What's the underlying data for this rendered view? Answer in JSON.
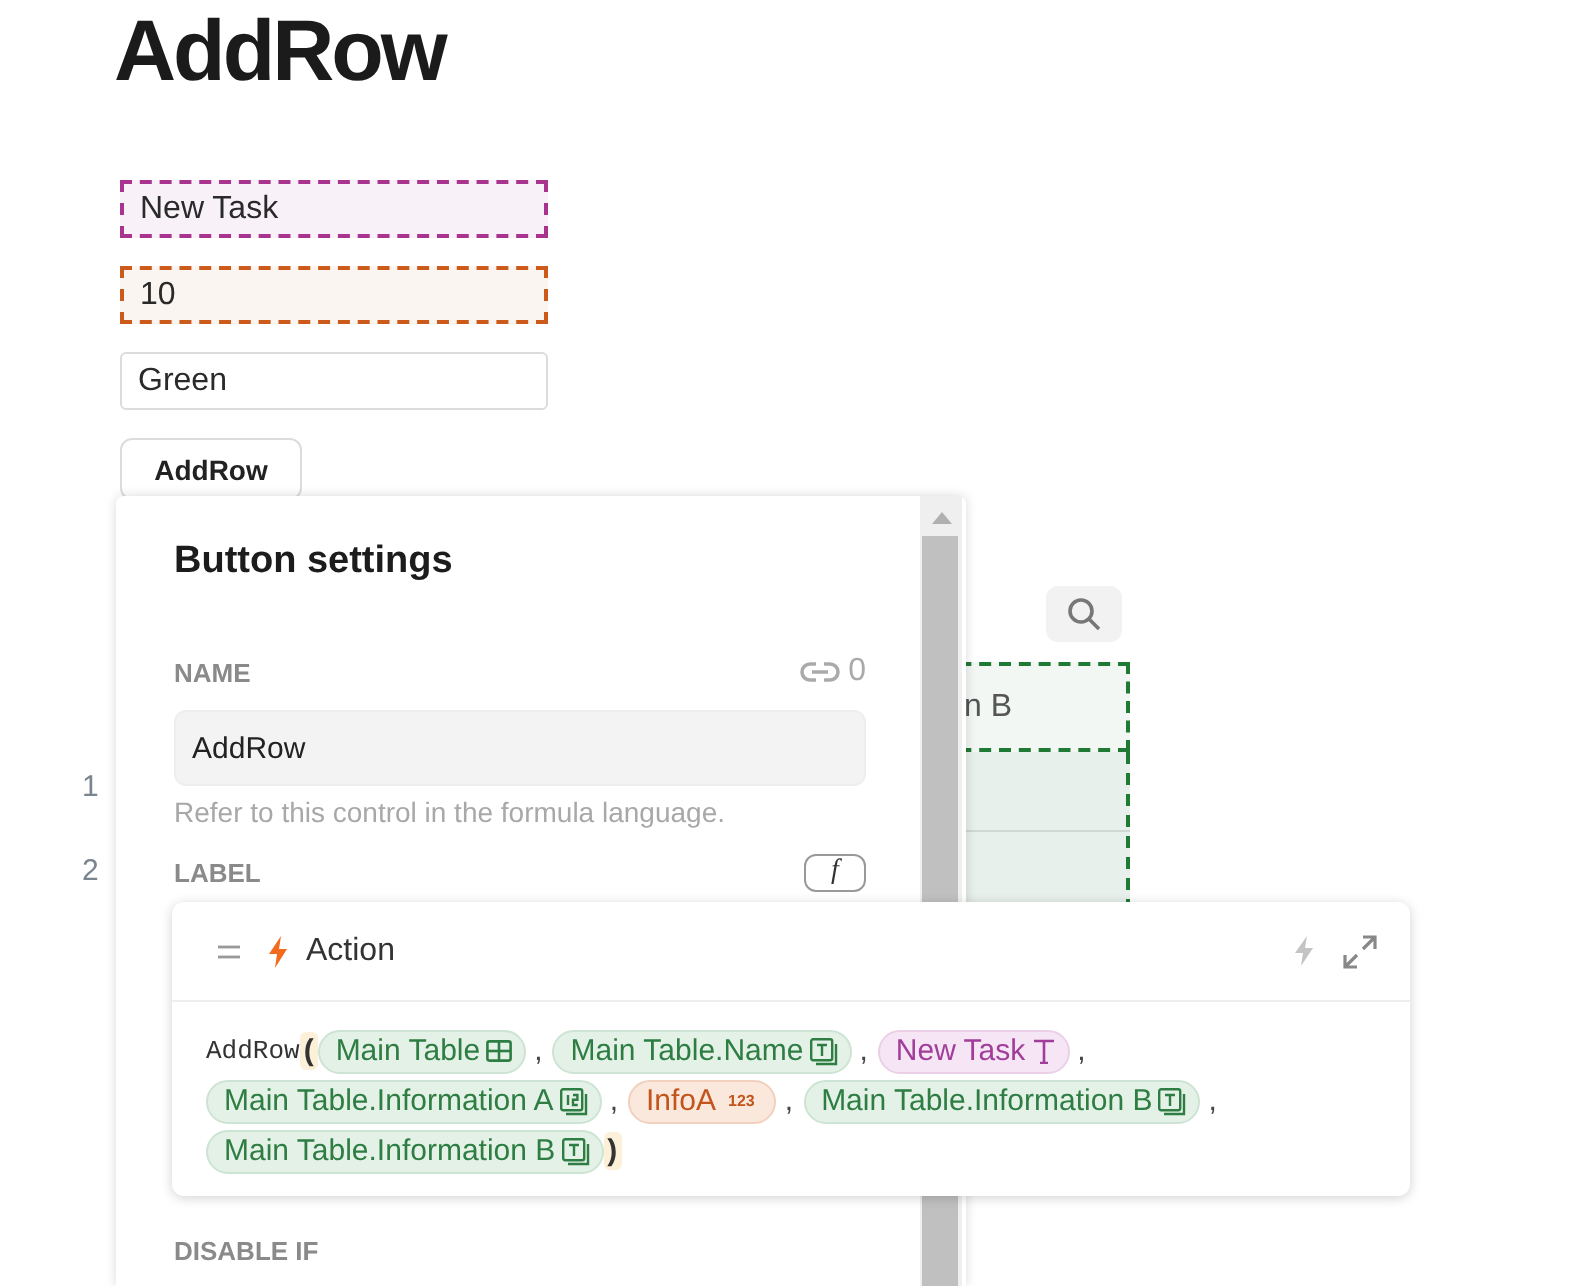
{
  "page": {
    "title": "AddRow"
  },
  "inputs": [
    {
      "kind": "text",
      "value": "New Task"
    },
    {
      "kind": "number",
      "value": "10"
    },
    {
      "kind": "plain",
      "value": "Green"
    }
  ],
  "button": {
    "label": "AddRow"
  },
  "canvas": {
    "table_header": "n B",
    "row_numbers": [
      "1",
      "2"
    ]
  },
  "settings_panel": {
    "title": "Button settings",
    "name": {
      "label": "NAME",
      "references": "0",
      "value": "AddRow",
      "hint": "Refer to this control in the formula language."
    },
    "label_field": {
      "label": "LABEL",
      "formula_button": "f"
    },
    "disable_if": {
      "label": "DISABLE IF"
    }
  },
  "formula_popup": {
    "title": "Action",
    "lines": [
      [
        {
          "kind": "function",
          "text": "AddRow"
        },
        {
          "kind": "paren",
          "text": "("
        },
        {
          "kind": "table",
          "text": "Main Table"
        },
        {
          "kind": "comma",
          "text": ","
        },
        {
          "kind": "column",
          "text": "Main Table.Name"
        },
        {
          "kind": "comma",
          "text": ","
        },
        {
          "kind": "text",
          "text": "New Task"
        },
        {
          "kind": "comma",
          "text": ","
        }
      ],
      [
        {
          "kind": "number-column",
          "text": "Main Table.Information A"
        },
        {
          "kind": "comma",
          "text": ","
        },
        {
          "kind": "number",
          "text": "InfoA",
          "badge": "123"
        },
        {
          "kind": "comma",
          "text": ","
        },
        {
          "kind": "column",
          "text": "Main Table.Information B"
        },
        {
          "kind": "comma",
          "text": ","
        }
      ],
      [
        {
          "kind": "column",
          "text": "Main Table.Information B"
        },
        {
          "kind": "paren",
          "text": ")"
        }
      ]
    ]
  }
}
